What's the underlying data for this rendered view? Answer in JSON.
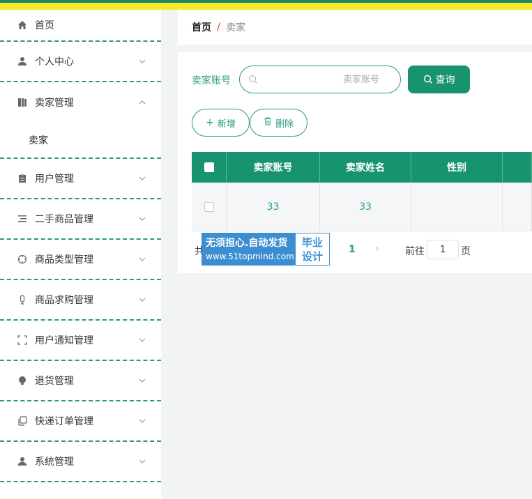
{
  "sidebar": {
    "home": "首页",
    "items": [
      {
        "label": "个人中心",
        "icon": "user-icon"
      },
      {
        "label": "卖家管理",
        "icon": "book-icon",
        "expanded": true,
        "children": [
          {
            "label": "卖家"
          }
        ]
      },
      {
        "label": "用户管理",
        "icon": "clipboard-icon"
      },
      {
        "label": "二手商品管理",
        "icon": "list-icon"
      },
      {
        "label": "商品类型管理",
        "icon": "crosshair-icon"
      },
      {
        "label": "商品求购管理",
        "icon": "microphone-icon"
      },
      {
        "label": "用户通知管理",
        "icon": "frame-icon"
      },
      {
        "label": "退货管理",
        "icon": "bulb-icon"
      },
      {
        "label": "快递订单管理",
        "icon": "copy-icon"
      },
      {
        "label": "系统管理",
        "icon": "person-icon"
      }
    ]
  },
  "breadcrumb": {
    "home": "首页",
    "separator": "/",
    "current": "卖家"
  },
  "search": {
    "label": "卖家账号",
    "placeholder": "卖家账号",
    "value": "",
    "button": "查询"
  },
  "actions": {
    "add": "新增",
    "delete": "删除"
  },
  "table": {
    "headers": [
      "卖家账号",
      "卖家姓名",
      "性别"
    ],
    "rows": [
      {
        "account": "33",
        "name": "33",
        "gender": ""
      }
    ]
  },
  "pagination": {
    "total_prefix": "共",
    "current_page": "1",
    "next": "›",
    "goto_label": "前往",
    "goto_value": "1",
    "page_suffix": "页"
  },
  "watermark": {
    "line1": "无须担心.自动发货",
    "line2": "www.51topmind.com",
    "right_top": "毕业",
    "right_bottom": "设计"
  },
  "colors": {
    "accent": "#17936f",
    "accent_border": "#2a9a83",
    "breadcrumb_sep": "#e0682a",
    "watermark_blue": "#3c8ed0"
  }
}
